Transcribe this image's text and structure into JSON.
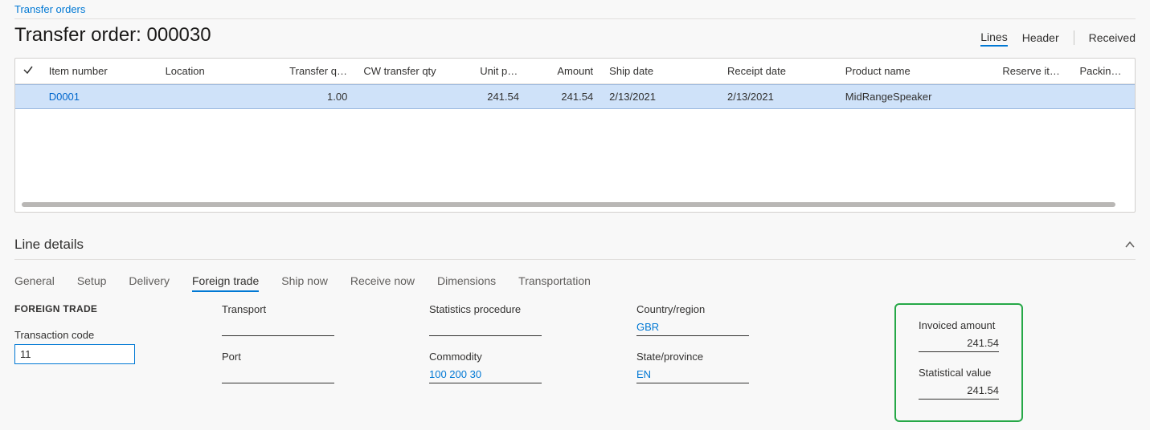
{
  "breadcrumb": "Transfer orders",
  "page_title": "Transfer order: 000030",
  "header_tabs": {
    "lines": "Lines",
    "header": "Header",
    "received": "Received"
  },
  "grid": {
    "cols": {
      "item": "Item number",
      "loc": "Location",
      "qty": "Transfer quantity",
      "cwqty": "CW transfer qty",
      "unit": "Unit price",
      "amount": "Amount",
      "ship": "Ship date",
      "rec": "Receipt date",
      "prod": "Product name",
      "res": "Reserve items a...",
      "pack": "Packing qu"
    },
    "row": {
      "item": "D0001",
      "loc": "",
      "qty": "1.00",
      "cwqty": "",
      "unit": "241.54",
      "amount": "241.54",
      "ship": "2/13/2021",
      "rec": "2/13/2021",
      "prod": "MidRangeSpeaker",
      "res": "",
      "pack": ""
    }
  },
  "details": {
    "heading": "Line details",
    "tabs": {
      "general": "General",
      "setup": "Setup",
      "delivery": "Delivery",
      "foreign": "Foreign trade",
      "shipnow": "Ship now",
      "recvnow": "Receive now",
      "dims": "Dimensions",
      "trans": "Transportation"
    },
    "group_title": "FOREIGN TRADE",
    "labels": {
      "txn": "Transaction code",
      "transport": "Transport",
      "port": "Port",
      "stat_proc": "Statistics procedure",
      "commodity": "Commodity",
      "country": "Country/region",
      "state": "State/province",
      "invoiced": "Invoiced amount",
      "statval": "Statistical value"
    },
    "values": {
      "txn": "11",
      "transport": "",
      "port": "",
      "stat_proc": "",
      "commodity": "100 200 30",
      "country": "GBR",
      "state": "EN",
      "invoiced": "241.54",
      "statval": "241.54"
    }
  }
}
